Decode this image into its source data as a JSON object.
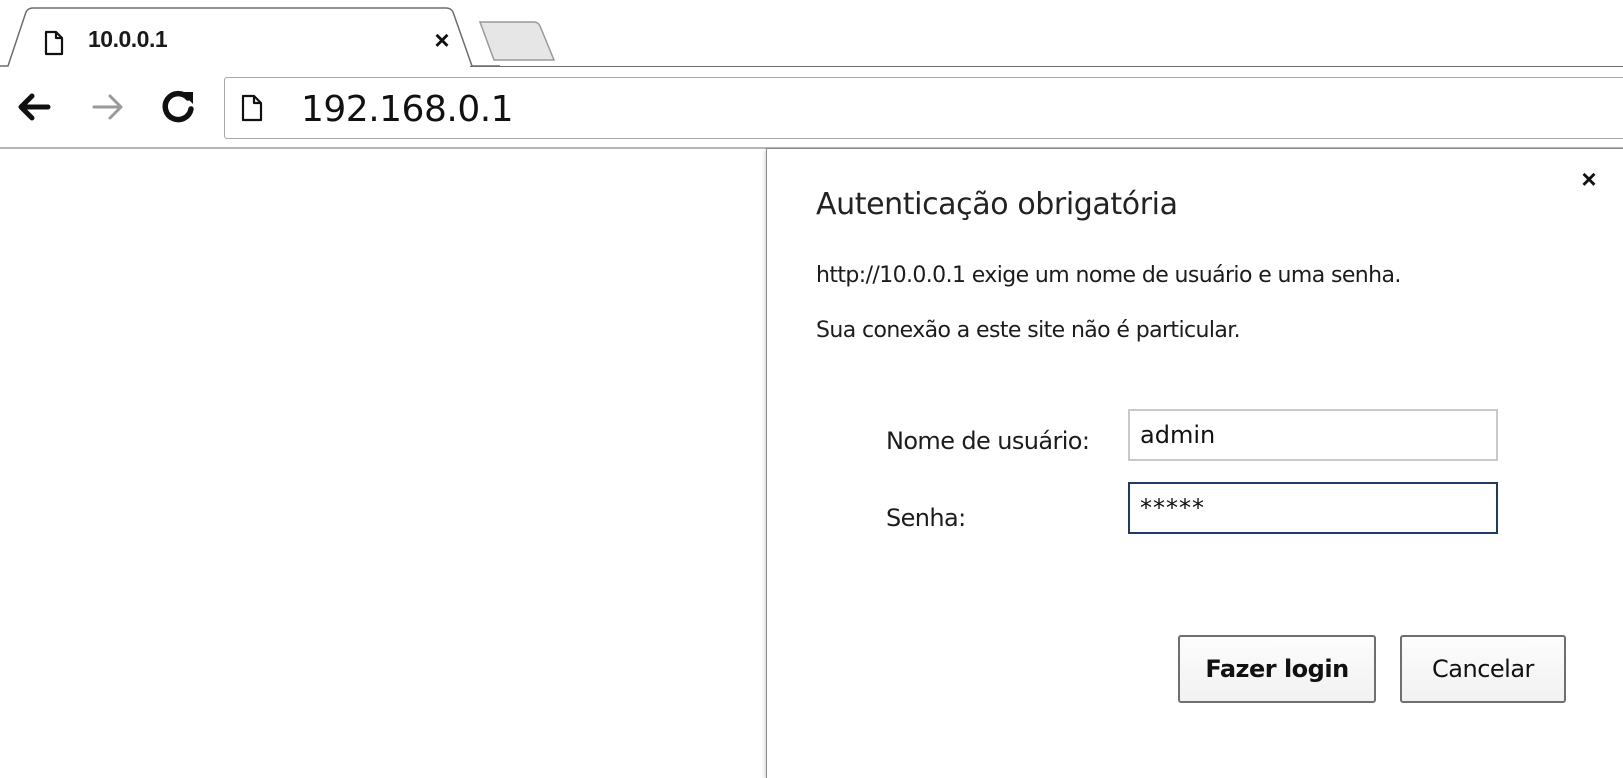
{
  "browser": {
    "tab": {
      "title": "10.0.0.1",
      "icon": "page-icon",
      "close_icon": "close-icon"
    },
    "toolbar": {
      "back_icon": "arrow-left-icon",
      "forward_icon": "arrow-right-icon",
      "reload_icon": "reload-icon",
      "page_icon": "page-icon",
      "url": "192.168.0.1"
    }
  },
  "dialog": {
    "title": "Autenticação obrigatória",
    "message_1": "http://10.0.0.1 exige um nome de usuário e uma senha.",
    "message_2": "Sua conexão a este site não é particular.",
    "username_label": "Nome de usuário:",
    "username_value": "admin",
    "password_label": "Senha:",
    "password_value": "*****",
    "login_label": "Fazer login",
    "cancel_label": "Cancelar",
    "close_icon": "close-icon",
    "focus_color": "#1e3a66"
  }
}
